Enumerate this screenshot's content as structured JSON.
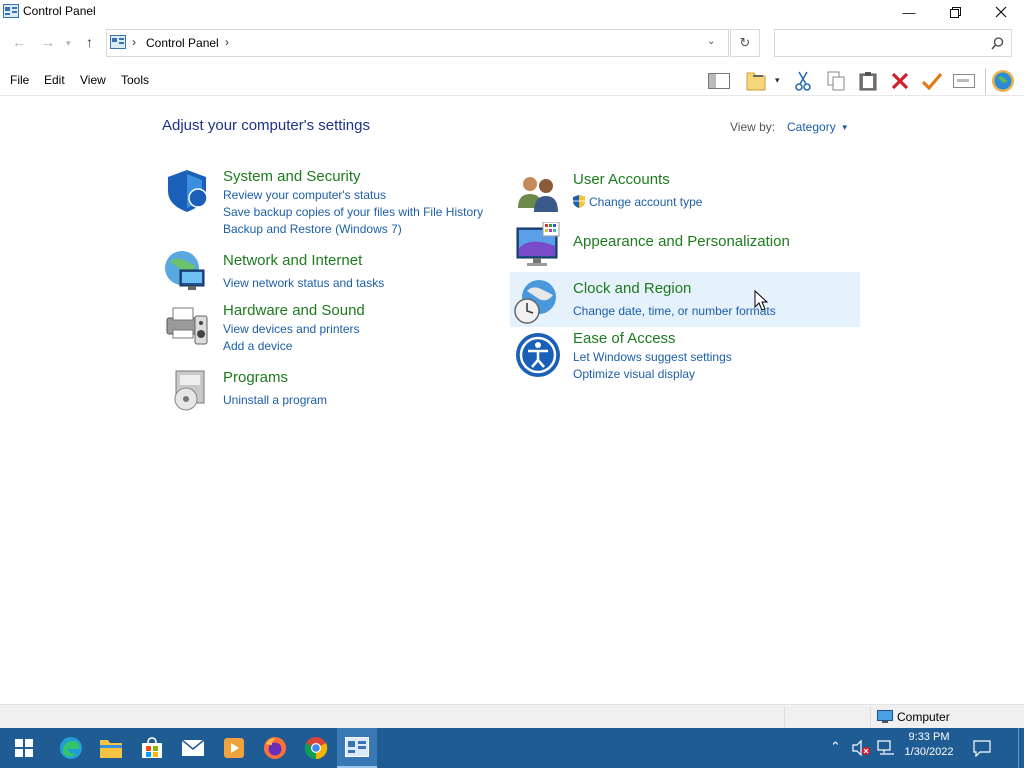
{
  "window": {
    "title": "Control Panel",
    "minimize_icon": "minimize-icon",
    "maximize_icon": "restore-icon",
    "close_icon": "close-icon"
  },
  "address": {
    "breadcrumb": [
      "Control Panel"
    ],
    "separator": "›",
    "search_placeholder": ""
  },
  "menu": [
    "File",
    "Edit",
    "View",
    "Tools"
  ],
  "main": {
    "heading": "Adjust your computer's settings",
    "view_by_label": "View by:",
    "view_by_value": "Category",
    "categories_left": [
      {
        "title": "System and Security",
        "links": [
          "Review your computer's status",
          "Save backup copies of your files with File History",
          "Backup and Restore (Windows 7)"
        ]
      },
      {
        "title": "Network and Internet",
        "links": [
          "View network status and tasks"
        ]
      },
      {
        "title": "Hardware and Sound",
        "links": [
          "View devices and printers",
          "Add a device"
        ]
      },
      {
        "title": "Programs",
        "links": [
          "Uninstall a program"
        ]
      }
    ],
    "categories_right": [
      {
        "title": "User Accounts",
        "links": [
          "Change account type"
        ]
      },
      {
        "title": "Appearance and Personalization",
        "links": []
      },
      {
        "title": "Clock and Region",
        "links": [
          "Change date, time, or number formats"
        ]
      },
      {
        "title": "Ease of Access",
        "links": [
          "Let Windows suggest settings",
          "Optimize visual display"
        ]
      }
    ]
  },
  "statusbar": {
    "location": "Computer"
  },
  "taskbar": {
    "time": "9:33 PM",
    "date": "1/30/2022",
    "apps": [
      "start-icon",
      "edge-icon",
      "file-explorer-icon",
      "store-icon",
      "mail-icon",
      "media-player-icon",
      "firefox-icon",
      "chrome-icon",
      "control-panel-icon"
    ]
  },
  "colors": {
    "taskbar": "#1f5c94",
    "link": "#1c5fa8",
    "category_title": "#1e7b1e",
    "heading": "#1e3287",
    "hover": "#e5f1fb"
  }
}
